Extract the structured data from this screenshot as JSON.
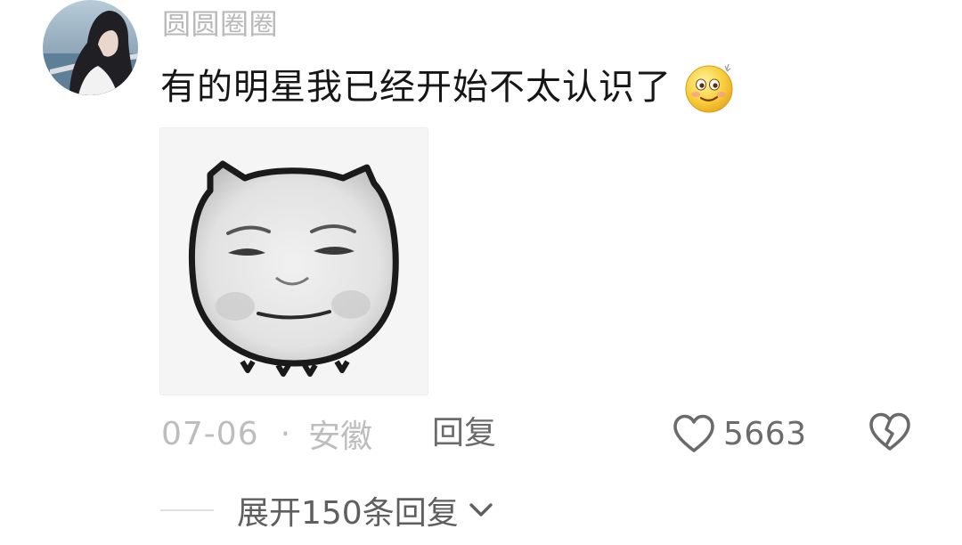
{
  "comment": {
    "username": "圆圆圈圈",
    "text": "有的明星我已经开始不太认识了",
    "emoji": "shy-smile-emoji",
    "sticker": "piglet-face-sticker",
    "date": "07-06",
    "separator": "·",
    "location": "安徽",
    "reply_label": "回复",
    "like_count": "5663",
    "expand_replies_label": "展开150条回复"
  },
  "colors": {
    "username": "#b9b9b9",
    "text": "#161616",
    "meta": "#bdbdbd",
    "action": "#6b6b6b",
    "icon_stroke": "#6a6a6a",
    "emoji_yellow": "#f6c736"
  }
}
